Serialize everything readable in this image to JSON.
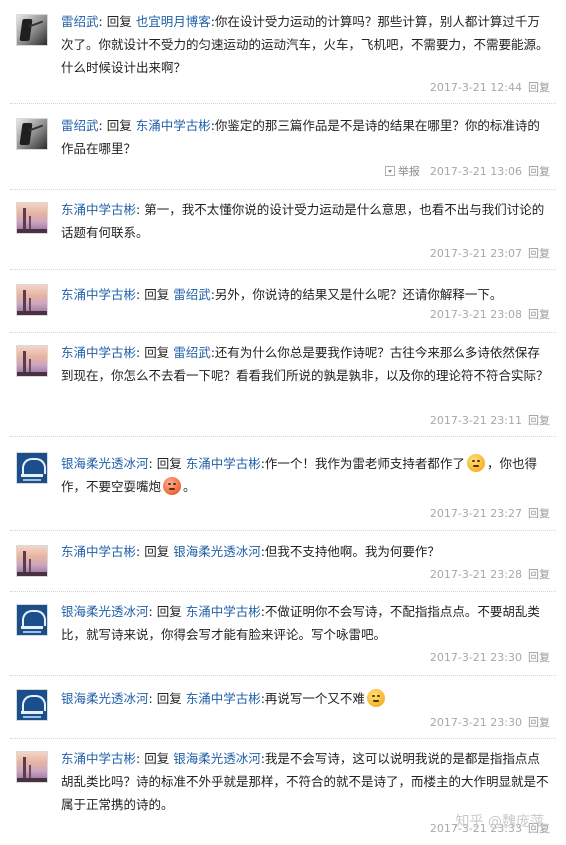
{
  "comments": [
    {
      "avatar": "landscape-bw-avatar",
      "author": "雷绍武",
      "reply_word": "回复",
      "target": "也宜明月博客",
      "text": ":你在设计受力运动的计算吗？那些计算，别人都计算过千万次了。你就设计不受力的匀速运动的运动汽车，火车，飞机吧，不需要力，不需要能源。什么时候设计出来啊？",
      "time": "2017-3-21 12:44",
      "reply_label": "回复"
    },
    {
      "avatar": "landscape-bw-avatar",
      "author": "雷绍武",
      "reply_word": "回复",
      "target": "东涌中学古彬",
      "text": ":你鉴定的那三篇作品是不是诗的结果在哪里？你的标准诗的作品在哪里？",
      "report_label": "举报",
      "time": "2017-3-21 13:06",
      "reply_label": "回复"
    },
    {
      "avatar": "sunset-tower-avatar",
      "author": "东涌中学古彬",
      "text": ": 第一，我不太懂你说的设计受力运动是什么意思，也看不出与我们讨论的话题有何联系。",
      "time": "2017-3-21 23:07",
      "reply_label": "回复"
    },
    {
      "avatar": "sunset-tower-avatar",
      "author": "东涌中学古彬",
      "reply_word": "回复",
      "target": "雷绍武",
      "text": ":另外，你说诗的结果又是什么呢？还请你解释一下。",
      "time": "2017-3-21 23:08",
      "reply_label": "回复"
    },
    {
      "avatar": "sunset-tower-avatar",
      "author": "东涌中学古彬",
      "reply_word": "回复",
      "target": "雷绍武",
      "text": ":还有为什么你总是要我作诗呢？古往今来那么多诗依然保存到现在，你怎么不去看一下呢？看看我们所说的孰是孰非，以及你的理论符不符合实际？",
      "time": "2017-3-21 23:11",
      "reply_label": "回复"
    },
    {
      "avatar": "blue-logo-avatar",
      "author": "银海柔光透冰河",
      "reply_word": "回复",
      "target": "东涌中学古彬",
      "text_a": ":作一个！我作为雷老师支持者都作了",
      "text_b": "，你也得作，不要空耍嘴炮",
      "text_c": "。",
      "time": "2017-3-21 23:27",
      "reply_label": "回复"
    },
    {
      "avatar": "sunset-tower-avatar",
      "author": "东涌中学古彬",
      "reply_word": "回复",
      "target": "银海柔光透冰河",
      "text": ":但我不支持他啊。我为何要作？",
      "time": "2017-3-21 23:28",
      "reply_label": "回复"
    },
    {
      "avatar": "blue-logo-avatar",
      "author": "银海柔光透冰河",
      "reply_word": "回复",
      "target": "东涌中学古彬",
      "text": ":不做证明你不会写诗，不配指指点点。不要胡乱类比，就写诗来说，你得会写才能有脸来评论。写个咏雷吧。",
      "time": "2017-3-21 23:30",
      "reply_label": "回复"
    },
    {
      "avatar": "blue-logo-avatar",
      "author": "银海柔光透冰河",
      "reply_word": "回复",
      "target": "东涌中学古彬",
      "text": ":再说写一个又不难",
      "time": "2017-3-21 23:30",
      "reply_label": "回复"
    },
    {
      "avatar": "sunset-tower-avatar",
      "author": "东涌中学古彬",
      "reply_word": "回复",
      "target": "银海柔光透冰河",
      "text": ":我是不会写诗，这可以说明我说的是都是指指点点胡乱类比吗？诗的标准不外乎就是那样，不符合的就不是诗了，而楼主的大作明显就是不属于正常携的诗的。",
      "time": "2017-3-21 23:33",
      "reply_label": "回复"
    }
  ],
  "watermark": "知乎 @魏庞萍"
}
